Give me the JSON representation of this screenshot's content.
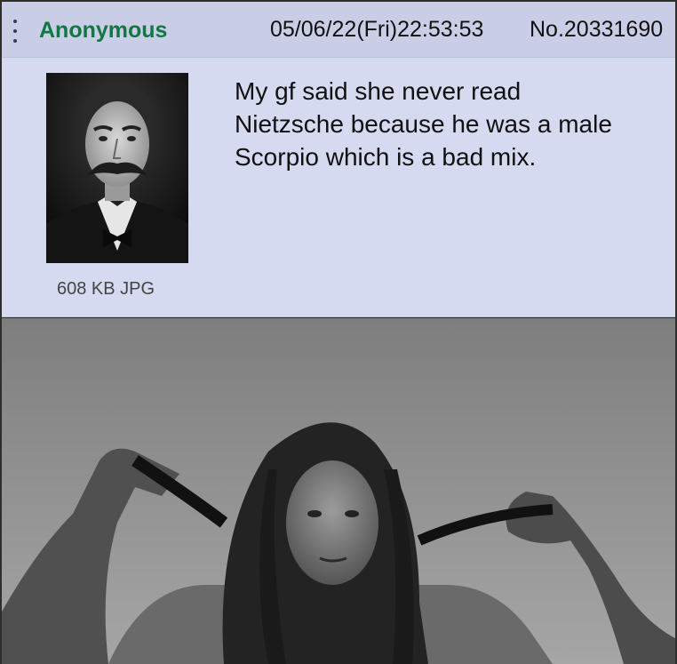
{
  "post": {
    "name": "Anonymous",
    "datetime": "05/06/22(Fri)22:53:53",
    "post_number": "No.20331690",
    "file_info": "608 KB JPG",
    "comment_lines": [
      "My gf said she never read",
      "Nietzsche because he was a male",
      "Scorpio which is a bad mix."
    ]
  },
  "colors": {
    "post_background": "#d6daf0",
    "header_background": "#c9cde6",
    "name_color": "#117743"
  },
  "icons": {
    "menu": "vertical-ellipsis-icon"
  }
}
